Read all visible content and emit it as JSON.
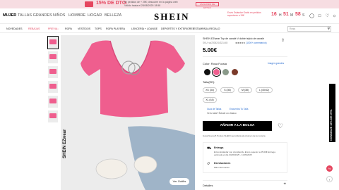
{
  "promo": {
    "big": "15% DE DTO.",
    "line1": "en pedidos de + 25€; descubre en la página web",
    "line2": "Válido hasta el 28/08/2025 18:58",
    "button": "UN MUNDO DE ESTILO"
  },
  "header": {
    "categories": [
      "MUJER",
      "TALLAS GRANDES",
      "NIÑOS",
      "HOMBRE",
      "HOGAR",
      "BELLEZA"
    ],
    "logo": "SHEIN",
    "countdown_label": "Envío Estándar Gratis en pedidos superiores a 15€",
    "countdown": [
      "16",
      "H",
      "51",
      "M",
      "58",
      "S"
    ]
  },
  "nav": {
    "items": [
      "NOVEDADES",
      "REBAJAS",
      "PREVIA↓",
      "ROPA",
      "VESTIDOS",
      "TOPS",
      "ROPA PLAYERA",
      "LENCERÍA + LOUNGE",
      "DEPORTES Y EXTERIORES",
      "ESTAMPADA REGALO"
    ],
    "search_placeholder": "Rosa"
  },
  "product": {
    "title": "SHEIN EZwear Top de canalé V doble tejido de canalé",
    "sku": "SKU: sw2306244321445",
    "stars": "★★★★★",
    "reviews": "(1000+ comentarios)",
    "price": "5.00€",
    "color_label": "Color: Rosa Fucsia",
    "guide": "Imagen grandes",
    "size_label": "Talla(EE):",
    "sizes": [
      "XS (34)",
      "S (36)",
      "M (38)",
      "L (40/42)",
      "XL (44)"
    ],
    "size_guide": "Guía de Tallas",
    "size_ref": "Encuentra Tu Talla",
    "fit_note": "Ve tu talla? Échale un vistazo",
    "add_to_bag": "AÑADIR A LA BOLSA",
    "perks": "Gana Nueva 8 Puntos SHEIN secundaria al volumen de la compra",
    "delivery_title": "Entrega",
    "delivery_text": "Envío Estándar con prioridad de Envío superior a 25.00€ Entrega estimada el día 04/09/2025 - 11/09/2025",
    "returns_title": "Devoluciones",
    "returns_text": "Más información",
    "details": "Detalles",
    "outfit_button": "Ver Outfits",
    "brand_watermark": "SHEIN EZwear"
  },
  "side_tab": "CONSIGUE 15% DE DTO.",
  "swatch_colors": [
    "#111111",
    "#ef5e8e",
    "#8a9a8a",
    "#7a3a2a"
  ],
  "colors": {
    "accent": "#e5465f",
    "link": "#2a6dd0",
    "primary_button": "#000000"
  }
}
